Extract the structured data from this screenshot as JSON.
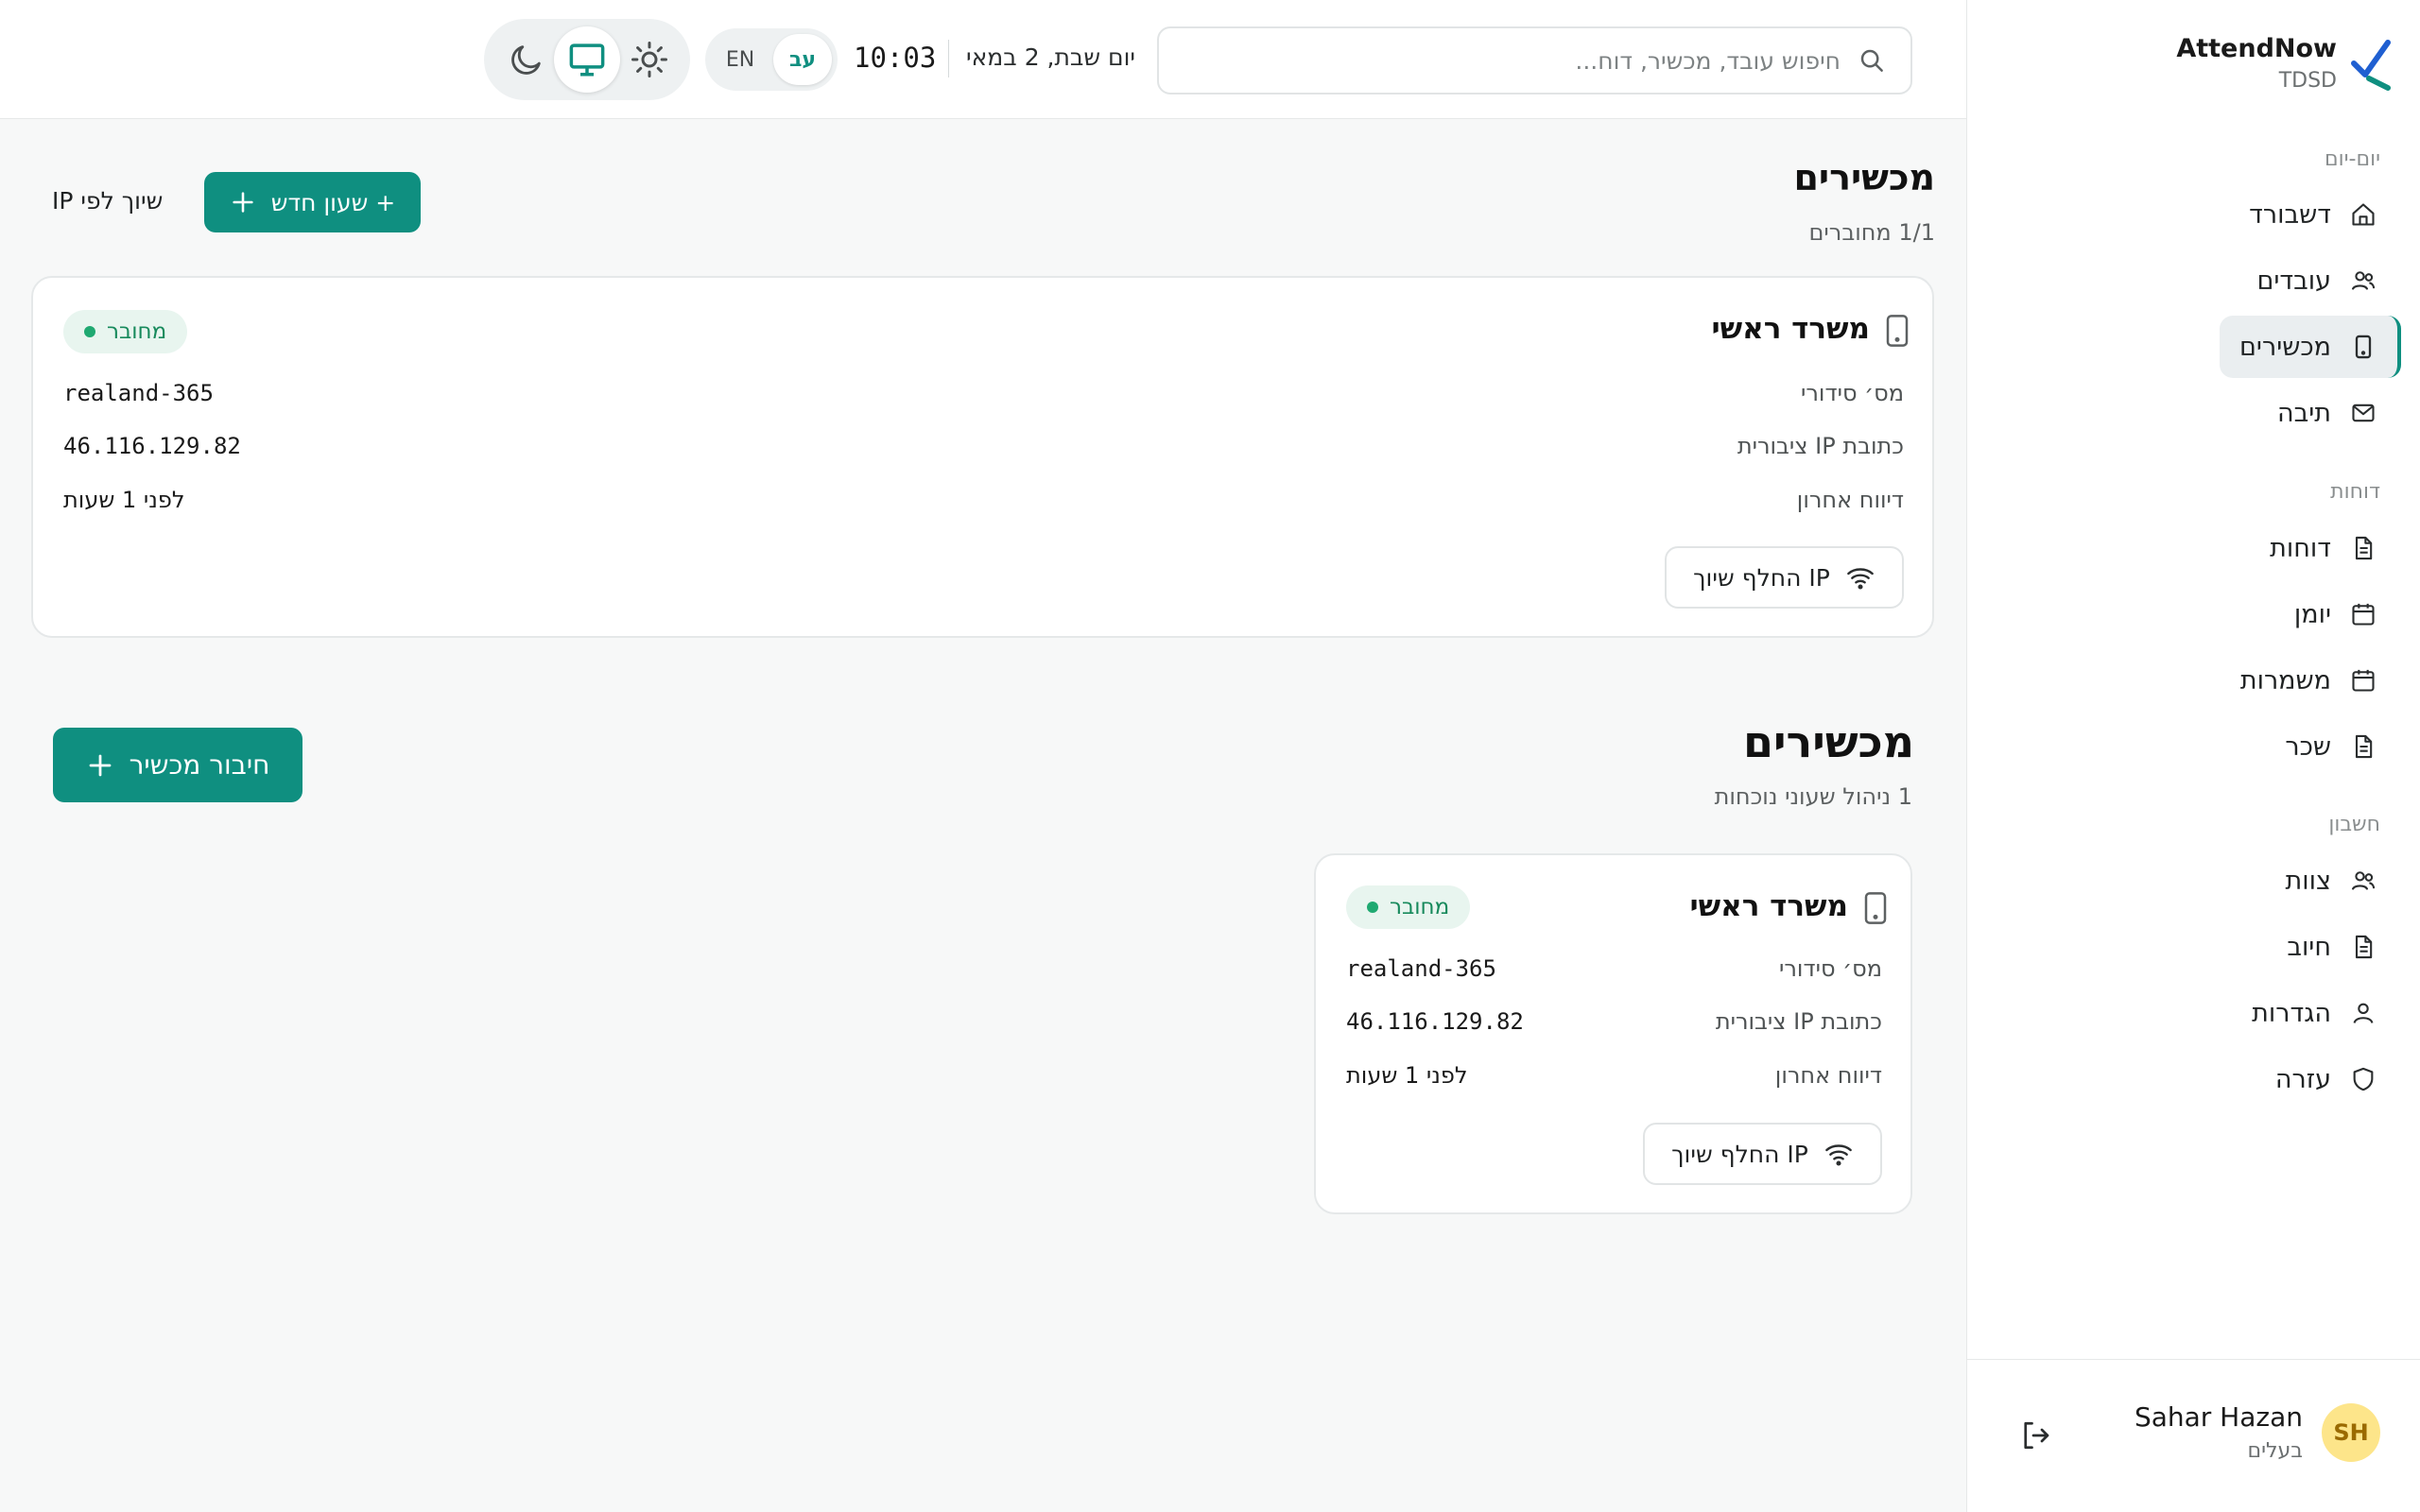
{
  "brand": {
    "name": "AttendNow",
    "sub": "TDSD"
  },
  "sidebar": {
    "sections": [
      {
        "title": "יום-יום",
        "items": [
          {
            "label": "דשבורד",
            "icon": "home-icon"
          },
          {
            "label": "עובדים",
            "icon": "users-icon"
          },
          {
            "label": "מכשירים",
            "icon": "device-icon",
            "active": true
          },
          {
            "label": "תיבה",
            "icon": "mail-icon"
          }
        ]
      },
      {
        "title": "דוחות",
        "items": [
          {
            "label": "דוחות",
            "icon": "file-icon"
          },
          {
            "label": "יומן",
            "icon": "calendar-icon"
          },
          {
            "label": "משמרות",
            "icon": "calendar-icon"
          },
          {
            "label": "שכר",
            "icon": "file-icon"
          }
        ]
      },
      {
        "title": "חשבון",
        "items": [
          {
            "label": "צוות",
            "icon": "users-icon"
          },
          {
            "label": "חיוב",
            "icon": "file-icon"
          },
          {
            "label": "הגדרות",
            "icon": "user-icon"
          },
          {
            "label": "עזרה",
            "icon": "shield-icon"
          }
        ]
      }
    ]
  },
  "user": {
    "initials": "SH",
    "name": "Sahar Hazan",
    "role": "בעלים"
  },
  "header": {
    "search_placeholder": "חיפוש עובד, מכשיר, דוח...",
    "date": "יום שבת, 2 במאי",
    "time": "10:03",
    "lang_en": "EN",
    "lang_he": "עב"
  },
  "colors": {
    "accent": "#0f8f80",
    "connected": "#1fa971",
    "avatar": "#fde58a"
  },
  "section1": {
    "title": "מכשירים",
    "subtitle": "1/1 מחוברים",
    "new_clock_button": "+ שעון חדש",
    "ip_assign_link": "שיוך לפי IP"
  },
  "section2": {
    "title": "מכשירים",
    "subtitle": "1 ניהול שעוני נוכחות",
    "connect_button": "חיבור מכשיר"
  },
  "device": {
    "name": "משרד ראשי",
    "status": "מחובר",
    "serial_label": "מס׳ סידורי",
    "serial_value": "realand-365",
    "ip_label": "כתובת IP ציבורית",
    "ip_value": "46.116.129.82",
    "last_report_label": "דיווח אחרון",
    "last_report_value": "לפני 1 שעות",
    "switch_ip_button": "החלף שיוך IP"
  }
}
